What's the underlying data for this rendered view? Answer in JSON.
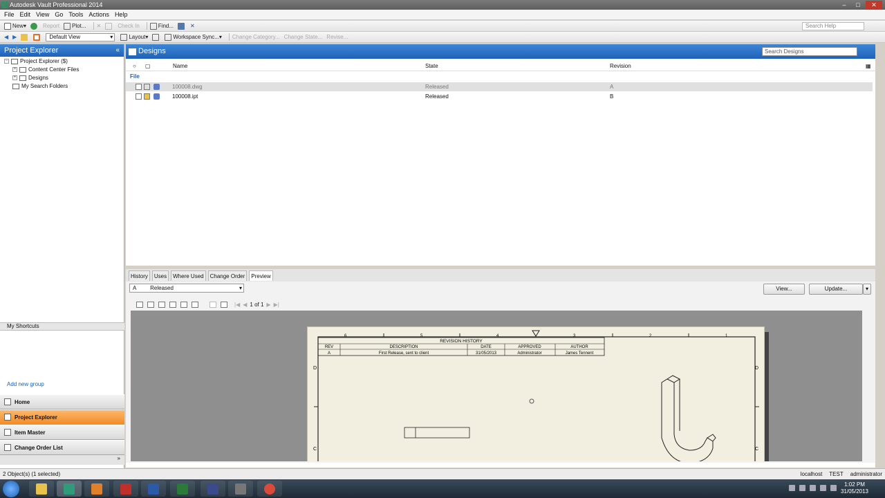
{
  "window": {
    "title": "Autodesk Vault Professional 2014"
  },
  "menu": [
    "File",
    "Edit",
    "View",
    "Go",
    "Tools",
    "Actions",
    "Help"
  ],
  "toolbar1": {
    "new": "New",
    "report": "Report",
    "plot": "Plot...",
    "checkin": "Check In",
    "find": "Find...",
    "search_help_placeholder": "Search Help"
  },
  "toolbar2": {
    "view": "Default View",
    "layout": "Layout",
    "workspace_sync": "Workspace Sync...",
    "change_category": "Change Category...",
    "change_state": "Change State...",
    "revise": "Revise..."
  },
  "left": {
    "header": "Project Explorer",
    "tree": [
      {
        "label": "Project Explorer ($)"
      },
      {
        "label": "Content Center Files"
      },
      {
        "label": "Designs"
      },
      {
        "label": "My Search Folders"
      }
    ],
    "shortcuts_header": "My Shortcuts",
    "add_group": "Add new group",
    "nav": [
      "Home",
      "Project Explorer",
      "Item Master",
      "Change Order List"
    ]
  },
  "main": {
    "header": "Designs",
    "search_placeholder": "Search Designs",
    "columns": {
      "name": "Name",
      "state": "State",
      "revision": "Revision"
    },
    "group": "File",
    "rows": [
      {
        "name": "100008.dwg",
        "state": "Released",
        "revision": "A"
      },
      {
        "name": "100008.ipt",
        "state": "Released",
        "revision": "B"
      }
    ]
  },
  "detail": {
    "tabs": [
      "History",
      "Uses",
      "Where Used",
      "Change Order",
      "Preview"
    ],
    "revision_select": {
      "rev": "A",
      "state": "Released"
    },
    "view_button": "View...",
    "update_button": "Update...",
    "page_indicator": "1 of 1"
  },
  "drawing": {
    "zone_numbers": [
      "6",
      "5",
      "4",
      "3",
      "2",
      "1"
    ],
    "zone_letters": [
      "D",
      "C"
    ],
    "rev_table": {
      "title": "REVISION HISTORY",
      "headers": [
        "REV",
        "DESCRIPTION",
        "DATE",
        "APPROVED",
        "AUTHOR"
      ],
      "row": [
        "A",
        "First Release, sent to client",
        "31/05/2013",
        "Administrator",
        "James Tennent"
      ]
    }
  },
  "status": {
    "left": "2 Object(s) (1 selected)",
    "server": "localhost",
    "vault": "TEST",
    "user": "administrator"
  },
  "taskbar": {
    "time": "1:02 PM",
    "date": "31/05/2013"
  },
  "colors": {
    "accent": "#1f62b8",
    "active_nav": "#f08c2a"
  }
}
